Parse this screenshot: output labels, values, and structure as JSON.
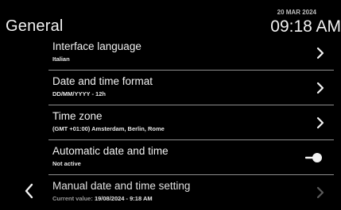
{
  "header": {
    "title": "General",
    "date": "20 MAR 2024",
    "time": "09:18 AM"
  },
  "settings": {
    "items": [
      {
        "label": "Interface language",
        "value": "Italian",
        "control": "chevron-right-icon",
        "enabled": true
      },
      {
        "label": "Date and time format",
        "value": "DD/MM/YYYY - 12h",
        "control": "chevron-right-icon",
        "enabled": true
      },
      {
        "label": "Time zone",
        "value": "(GMT +01:00) Amsterdam, Berlin, Rome",
        "control": "chevron-right-icon",
        "enabled": true
      },
      {
        "label": "Automatic date and time",
        "value": "Not active",
        "control": "toggle-switch",
        "toggle_on": false,
        "enabled": true
      },
      {
        "label": "Manual date and time setting",
        "value_prefix": "Current value: ",
        "value": "19/08/2024 - 9:18 AM",
        "control": "chevron-right-icon",
        "enabled": false
      }
    ]
  },
  "nav": {
    "back_icon": "chevron-left-icon"
  },
  "colors": {
    "background": "#000000",
    "text": "#f2f2f2",
    "divider": "#8f8f8f",
    "disabled_chevron": "#5a5a5a"
  }
}
